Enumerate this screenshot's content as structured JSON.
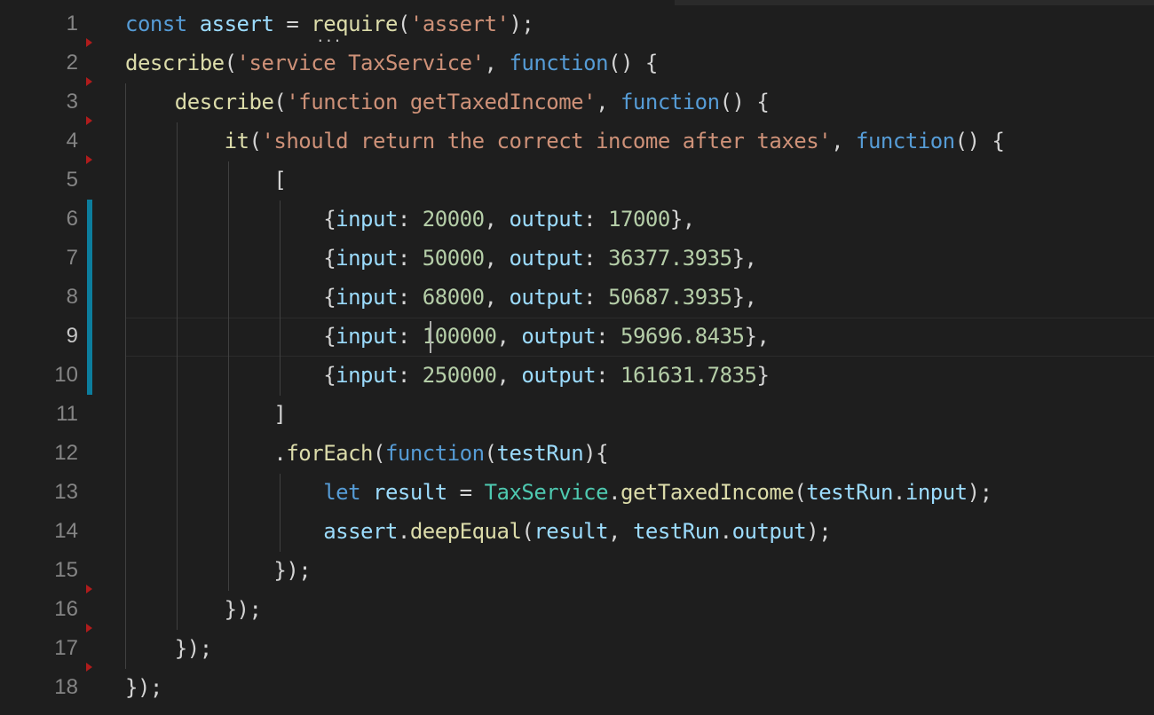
{
  "editor": {
    "language": "javascript",
    "active_line": 9,
    "lines": [
      {
        "n": "1",
        "tokens": [
          [
            "const",
            "kw"
          ],
          [
            " ",
            "pun"
          ],
          [
            "assert",
            "var"
          ],
          [
            " = ",
            "pun"
          ],
          [
            "require",
            "fn"
          ],
          [
            "(",
            "pun"
          ],
          [
            "'assert'",
            "str"
          ],
          [
            ");",
            "pun"
          ]
        ]
      },
      {
        "n": "2",
        "tokens": [
          [
            "describe",
            "fn"
          ],
          [
            "(",
            "pun"
          ],
          [
            "'service TaxService'",
            "str"
          ],
          [
            ", ",
            "pun"
          ],
          [
            "function",
            "kw"
          ],
          [
            "() {",
            "pun"
          ]
        ]
      },
      {
        "n": "3",
        "tokens": [
          [
            "    ",
            "pun"
          ],
          [
            "describe",
            "fn"
          ],
          [
            "(",
            "pun"
          ],
          [
            "'function getTaxedIncome'",
            "str"
          ],
          [
            ", ",
            "pun"
          ],
          [
            "function",
            "kw"
          ],
          [
            "() {",
            "pun"
          ]
        ]
      },
      {
        "n": "4",
        "tokens": [
          [
            "        ",
            "pun"
          ],
          [
            "it",
            "fn"
          ],
          [
            "(",
            "pun"
          ],
          [
            "'should return the correct income after taxes'",
            "str"
          ],
          [
            ", ",
            "pun"
          ],
          [
            "function",
            "kw"
          ],
          [
            "() {",
            "pun"
          ]
        ]
      },
      {
        "n": "5",
        "tokens": [
          [
            "            [",
            "pun"
          ]
        ]
      },
      {
        "n": "6",
        "tokens": [
          [
            "                {",
            "pun"
          ],
          [
            "input",
            "var"
          ],
          [
            ": ",
            "pun"
          ],
          [
            "20000",
            "num"
          ],
          [
            ", ",
            "pun"
          ],
          [
            "output",
            "var"
          ],
          [
            ": ",
            "pun"
          ],
          [
            "17000",
            "num"
          ],
          [
            "},",
            "pun"
          ]
        ]
      },
      {
        "n": "7",
        "tokens": [
          [
            "                {",
            "pun"
          ],
          [
            "input",
            "var"
          ],
          [
            ": ",
            "pun"
          ],
          [
            "50000",
            "num"
          ],
          [
            ", ",
            "pun"
          ],
          [
            "output",
            "var"
          ],
          [
            ": ",
            "pun"
          ],
          [
            "36377.3935",
            "num"
          ],
          [
            "},",
            "pun"
          ]
        ]
      },
      {
        "n": "8",
        "tokens": [
          [
            "                {",
            "pun"
          ],
          [
            "input",
            "var"
          ],
          [
            ": ",
            "pun"
          ],
          [
            "68000",
            "num"
          ],
          [
            ", ",
            "pun"
          ],
          [
            "output",
            "var"
          ],
          [
            ": ",
            "pun"
          ],
          [
            "50687.3935",
            "num"
          ],
          [
            "},",
            "pun"
          ]
        ]
      },
      {
        "n": "9",
        "tokens": [
          [
            "                {",
            "pun"
          ],
          [
            "input",
            "var"
          ],
          [
            ": ",
            "pun"
          ],
          [
            "100000",
            "num"
          ],
          [
            ", ",
            "pun"
          ],
          [
            "output",
            "var"
          ],
          [
            ": ",
            "pun"
          ],
          [
            "59696.8435",
            "num"
          ],
          [
            "},",
            "pun"
          ]
        ]
      },
      {
        "n": "10",
        "tokens": [
          [
            "                {",
            "pun"
          ],
          [
            "input",
            "var"
          ],
          [
            ": ",
            "pun"
          ],
          [
            "250000",
            "num"
          ],
          [
            ", ",
            "pun"
          ],
          [
            "output",
            "var"
          ],
          [
            ": ",
            "pun"
          ],
          [
            "161631.7835",
            "num"
          ],
          [
            "}",
            "pun"
          ]
        ]
      },
      {
        "n": "11",
        "tokens": [
          [
            "            ]",
            "pun"
          ]
        ]
      },
      {
        "n": "12",
        "tokens": [
          [
            "            .",
            "pun"
          ],
          [
            "forEach",
            "fn"
          ],
          [
            "(",
            "pun"
          ],
          [
            "function",
            "kw"
          ],
          [
            "(",
            "pun"
          ],
          [
            "testRun",
            "var"
          ],
          [
            "){",
            "pun"
          ]
        ]
      },
      {
        "n": "13",
        "tokens": [
          [
            "                ",
            "pun"
          ],
          [
            "let",
            "kw"
          ],
          [
            " ",
            "pun"
          ],
          [
            "result",
            "var"
          ],
          [
            " = ",
            "pun"
          ],
          [
            "TaxService",
            "cls"
          ],
          [
            ".",
            "pun"
          ],
          [
            "getTaxedIncome",
            "fn"
          ],
          [
            "(",
            "pun"
          ],
          [
            "testRun",
            "var"
          ],
          [
            ".",
            "pun"
          ],
          [
            "input",
            "var"
          ],
          [
            ");",
            "pun"
          ]
        ]
      },
      {
        "n": "14",
        "tokens": [
          [
            "                ",
            "pun"
          ],
          [
            "assert",
            "var"
          ],
          [
            ".",
            "pun"
          ],
          [
            "deepEqual",
            "fn"
          ],
          [
            "(",
            "pun"
          ],
          [
            "result",
            "var"
          ],
          [
            ", ",
            "pun"
          ],
          [
            "testRun",
            "var"
          ],
          [
            ".",
            "pun"
          ],
          [
            "output",
            "var"
          ],
          [
            ");",
            "pun"
          ]
        ]
      },
      {
        "n": "15",
        "tokens": [
          [
            "            });",
            "pun"
          ]
        ]
      },
      {
        "n": "16",
        "tokens": [
          [
            "        });",
            "pun"
          ]
        ]
      },
      {
        "n": "17",
        "tokens": [
          [
            "    });",
            "pun"
          ]
        ]
      },
      {
        "n": "18",
        "tokens": [
          [
            "});",
            "pun"
          ]
        ]
      }
    ],
    "modified_lines": [
      6,
      7,
      8,
      9,
      10
    ],
    "fold_markers_after_lines": [
      1,
      2,
      3,
      4,
      15,
      16,
      17
    ],
    "hint_text": "...",
    "colors": {
      "background": "#1e1e1e",
      "keyword": "#569cd6",
      "variable": "#9cdcfe",
      "function": "#dcdcaa",
      "string": "#ce9178",
      "number": "#b5cea8",
      "class": "#4ec9b0",
      "punctuation": "#d4d4d4",
      "line_number": "#858585",
      "change_bar": "#0c7d9d",
      "fold_marker": "#b01c1c"
    }
  }
}
